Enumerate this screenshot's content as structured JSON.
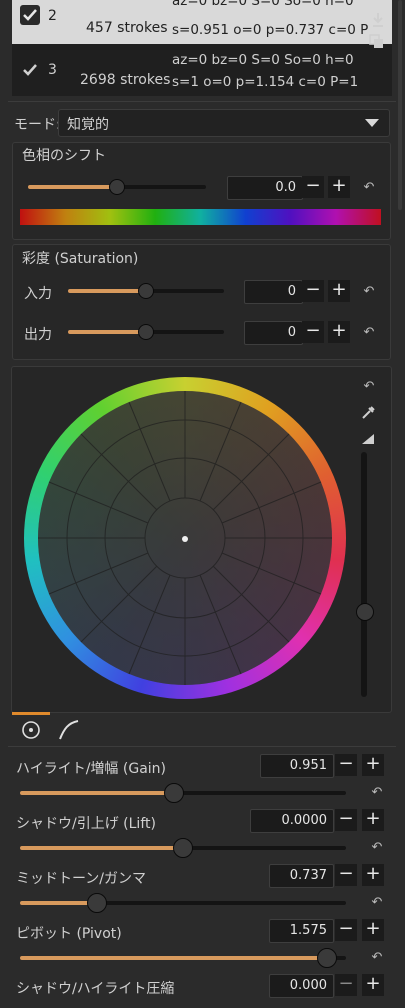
{
  "history": {
    "rows": [
      {
        "num": "2",
        "strokes": "457 strokes",
        "params_top": "az=0 bz=0 S=0 So=0 h=0",
        "params_bottom": "s=0.951 o=0 p=0.737 c=0 P",
        "selected": true
      },
      {
        "num": "3",
        "strokes": "2698 strokes",
        "params_top": "az=0 bz=0 S=0 So=0 h=0",
        "params_bottom": "s=1 o=0 p=1.154 c=0 P=1",
        "selected": false
      }
    ]
  },
  "mode": {
    "label": "モード:",
    "value": "知覚的"
  },
  "hue_shift": {
    "title": "色相のシフト",
    "value": "0.0",
    "slider_fraction": 0.5
  },
  "saturation": {
    "title": "彩度 (Saturation)",
    "input": {
      "label": "入力",
      "value": "0",
      "slider_fraction": 0.5
    },
    "output": {
      "label": "出力",
      "value": "0",
      "slider_fraction": 0.5
    }
  },
  "wheel": {
    "vertical_slider_fraction": 0.65
  },
  "params": [
    {
      "label": "ハイライト/増幅 (Gain)",
      "value": "0.951",
      "slider_fraction": 0.476
    },
    {
      "label": "シャドウ/引上げ (Lift)",
      "value": "0.0000",
      "slider_fraction": 0.5
    },
    {
      "label": "ミッドトーン/ガンマ",
      "value": "0.737",
      "slider_fraction": 0.25
    },
    {
      "label": "ピボット (Pivot)",
      "value": "1.575",
      "slider_fraction": 0.98
    },
    {
      "label": "シャドウ/ハイライト圧縮",
      "value": "0.000"
    }
  ],
  "colors": {
    "accent": "#e08a2c",
    "fill": "#d89a5d",
    "bg": "#2b2b2b"
  }
}
